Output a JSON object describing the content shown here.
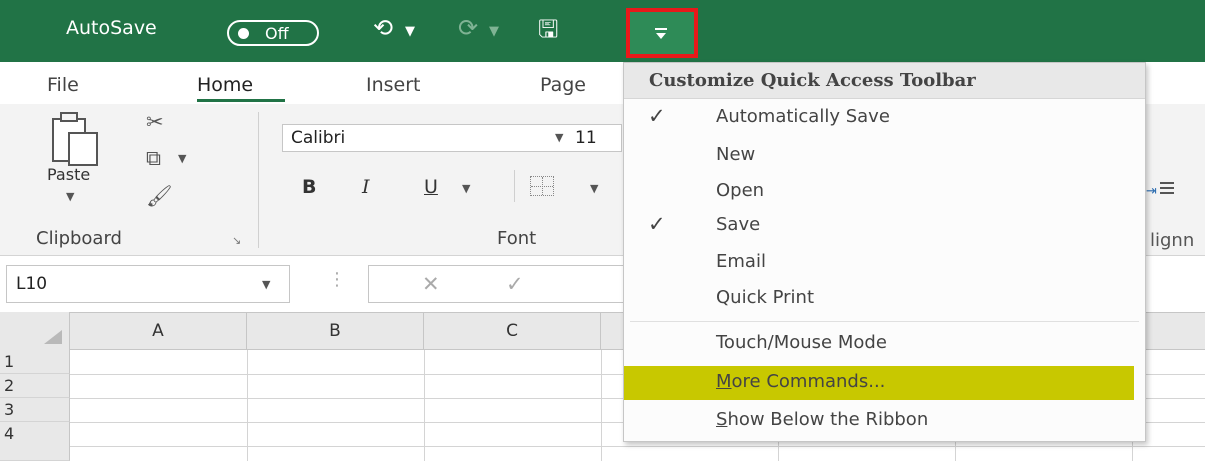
{
  "titlebar": {
    "autosave_label": "AutoSave",
    "autosave_state": "Off",
    "icons": [
      "undo-icon",
      "redo-icon",
      "save-icon",
      "customize-quick-access-toolbar-icon"
    ],
    "accent": "#217346",
    "highlight_border": "#e8191a"
  },
  "tabs": [
    "File",
    "Home",
    "Insert",
    "Page"
  ],
  "ribbon": {
    "paste_label": "Paste",
    "clipboard_label": "Clipboard",
    "font_group_label": "Font",
    "font_name": "Calibri",
    "font_size": "11",
    "bold": "B",
    "italic": "I",
    "underline": "U",
    "alignment_fragment": "lignn"
  },
  "formula_bar": {
    "name_box": "L10"
  },
  "grid": {
    "columns": [
      "A",
      "B",
      "C"
    ],
    "rows": [
      "1",
      "2",
      "3",
      "4"
    ]
  },
  "menu": {
    "title": "Customize Quick Access Toolbar",
    "items": [
      {
        "label": "Automatically Save",
        "checked": true
      },
      {
        "label": "New",
        "checked": false
      },
      {
        "label": "Open",
        "checked": false
      },
      {
        "label": "Save",
        "checked": true
      },
      {
        "label": "Email",
        "checked": false
      },
      {
        "label": "Quick Print",
        "checked": false
      },
      {
        "label": "Touch/Mouse Mode",
        "checked": false
      },
      {
        "label": "More Commands...",
        "checked": false,
        "highlighted": true,
        "mnemonic": "M"
      },
      {
        "label": "Show Below the Ribbon",
        "checked": false,
        "mnemonic": "S"
      }
    ],
    "highlight_color": "#c8c800"
  }
}
